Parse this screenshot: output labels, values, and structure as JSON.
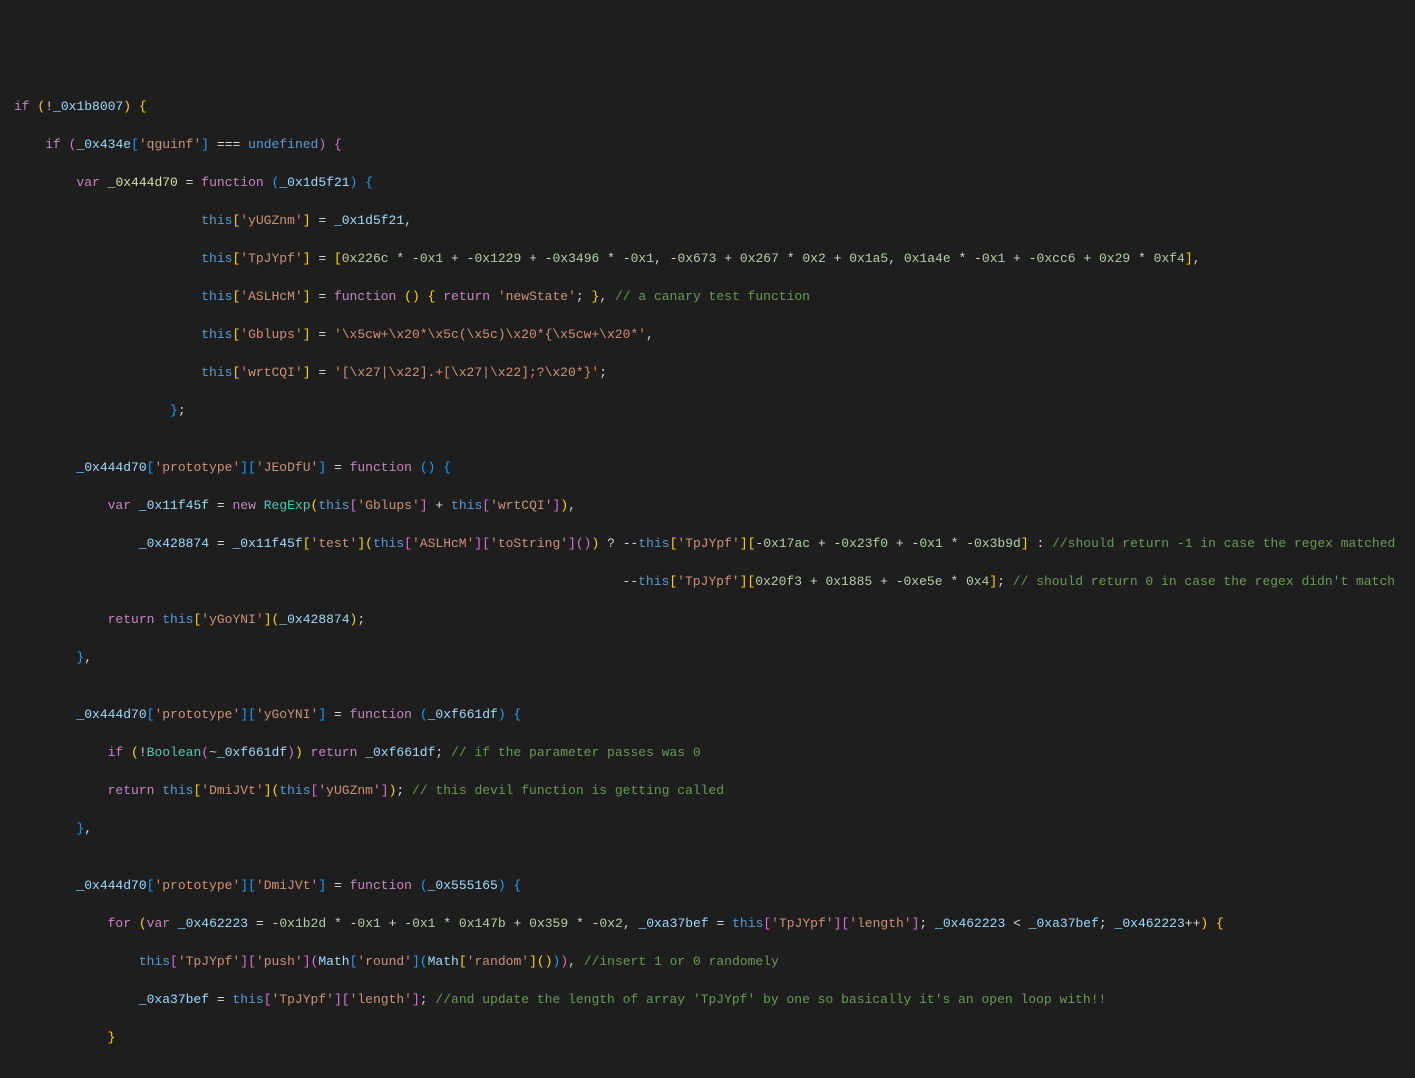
{
  "code": {
    "lines": [
      {
        "t": "if (!_0x1b8007) {"
      },
      {
        "t": "    if (_0x434e['qguinf'] === undefined) {"
      },
      {
        "t": "        var _0x444d70 = function (_0x1d5f21) {"
      },
      {
        "t": "                        this['yUGZnm'] = _0x1d5f21,"
      },
      {
        "t": "                        this['TpJYpf'] = [0x226c * -0x1 + -0x1229 + -0x3496 * -0x1, -0x673 + 0x267 * 0x2 + 0x1a5, 0x1a4e * -0x1 + -0xcc6 + 0x29 * 0xf4],"
      },
      {
        "t": "                        this['ASLHcM'] = function () { return 'newState'; }, // a canary test function"
      },
      {
        "t": "                        this['Gblups'] = '\\x5cw+\\x20*\\x5c(\\x5c)\\x20*{\\x5cw+\\x20*',"
      },
      {
        "t": "                        this['wrtCQI'] = '[\\x27|\\x22].+[\\x27|\\x22];?\\x20*}';"
      },
      {
        "t": "                    };"
      },
      {
        "t": ""
      },
      {
        "t": "        _0x444d70['prototype']['JEoDfU'] = function () {"
      },
      {
        "t": "            var _0x11f45f = new RegExp(this['Gblups'] + this['wrtCQI']),"
      },
      {
        "t": "                _0x428874 = _0x11f45f['test'](this['ASLHcM']['toString']()) ? --this['TpJYpf'][-0x17ac + -0x23f0 + -0x1 * -0x3b9d] : //should return -1 in case the regex matched"
      },
      {
        "t": "                                                                              --this['TpJYpf'][0x20f3 + 0x1885 + -0xe5e * 0x4]; // should return 0 in case the regex didn't match"
      },
      {
        "t": "            return this['yGoYNI'](_0x428874);"
      },
      {
        "t": "        },"
      },
      {
        "t": ""
      },
      {
        "t": "        _0x444d70['prototype']['yGoYNI'] = function (_0xf661df) {"
      },
      {
        "t": "            if (!Boolean(~_0xf661df)) return _0xf661df; // if the parameter passes was 0"
      },
      {
        "t": "            return this['DmiJVt'](this['yUGZnm']); // this devil function is getting called"
      },
      {
        "t": "        },"
      },
      {
        "t": ""
      },
      {
        "t": "        _0x444d70['prototype']['DmiJVt'] = function (_0x555165) {"
      },
      {
        "t": "            for (var _0x462223 = -0x1b2d * -0x1 + -0x1 * 0x147b + 0x359 * -0x2, _0xa37bef = this['TpJYpf']['length']; _0x462223 < _0xa37bef; _0x462223++) {"
      },
      {
        "t": "                this['TpJYpf']['push'](Math['round'](Math['random']())), //insert 1 or 0 randomely"
      },
      {
        "t": "                _0xa37bef = this['TpJYpf']['length']; //and update the length of array 'TpJYpf' by one so basically it's an open loop with!!"
      },
      {
        "t": "            }"
      }
    ]
  }
}
